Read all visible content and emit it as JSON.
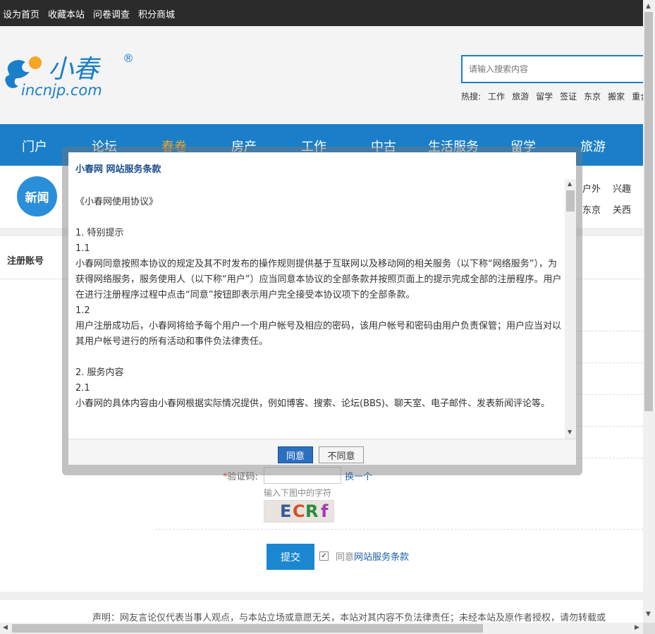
{
  "topbar": {
    "links": [
      "设为首页",
      "收藏本站",
      "问卷调查",
      "积分商城"
    ]
  },
  "logo": {
    "text_cn": "小春",
    "text_url": "incnjp.com",
    "registered": "®"
  },
  "search": {
    "placeholder": "请输入搜索内容",
    "hot_label": "热搜:",
    "hot_terms": [
      "工作",
      "旅游",
      "留学",
      "签证",
      "东京",
      "搬家",
      "重合"
    ]
  },
  "nav": {
    "items": [
      "门户",
      "论坛",
      "春卷",
      "房产",
      "工作",
      "中古",
      "生活服务",
      "留学",
      "旅游"
    ],
    "active": "春卷"
  },
  "subnav": {
    "badge": "新闻",
    "links_right": [
      "户外",
      "兴趣",
      "东京",
      "关西"
    ]
  },
  "form": {
    "side_title": "注册账号",
    "captcha_label": "验证码:",
    "captcha_required": "*",
    "captcha_refresh": "换一个",
    "captcha_hint": "输入下图中的字符",
    "captcha_text": [
      "E",
      "C",
      "R",
      "f"
    ],
    "submit_label": "提交",
    "agree_prefix": "同意",
    "agree_link": "网站服务条款"
  },
  "footer": {
    "text": "声明：网友言论仅代表当事人观点，与本站立场或意愿无关，本站对其内容不负法律责任；未经本站及原作者授权，请勿转载或"
  },
  "modal": {
    "title": "小春网 网站服务条款",
    "paragraphs": [
      "《小春网使用协议》",
      "",
      "1. 特别提示",
      "1.1",
      "小春网同意按照本协议的规定及其不时发布的操作规则提供基于互联网以及移动网的相关服务（以下称“网络服务”），为获得网络服务，服务使用人（以下称“用户”）应当同意本协议的全部条款并按照页面上的提示完成全部的注册程序。用户在进行注册程序过程中点击“同意”按钮即表示用户完全接受本协议项下的全部条款。",
      "1.2",
      "用户注册成功后，小春网将给予每个用户一个用户帐号及相应的密码，该用户帐号和密码由用户负责保管；用户应当对以其用户帐号进行的所有活动和事件负法律责任。",
      "",
      "2. 服务内容",
      "2.1",
      "小春网的具体内容由小春网根据实际情况提供，例如博客、搜索、论坛(BBS)、聊天室、电子邮件、发表新闻评论等。"
    ],
    "agree_button": "同意",
    "disagree_button": "不同意"
  },
  "colors": {
    "nav_blue": "#1a7fc8",
    "active_orange": "#f5a623",
    "topbar": "#2b2b2b"
  }
}
